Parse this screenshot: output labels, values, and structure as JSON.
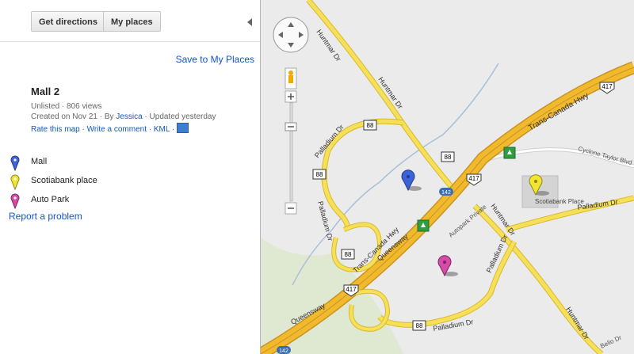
{
  "toolbar": {
    "directions": "Get directions",
    "my_places": "My places"
  },
  "panel": {
    "save_link": "Save to My Places",
    "map_title": "Mall 2",
    "visibility": "Unlisted",
    "views": "806 views",
    "created_prefix": "Created on Nov 21 · By",
    "author": "Jessica",
    "updated": "· Updated yesterday",
    "rate": "Rate this map",
    "comment": "Write a comment",
    "kml": "KML",
    "places": [
      {
        "label": "Mall",
        "color": "#3d63d9"
      },
      {
        "label": "Scotiabank place",
        "color": "#f2e52e"
      },
      {
        "label": "Auto Park",
        "color": "#d64aa8"
      }
    ],
    "report": "Report a problem"
  },
  "map": {
    "labels": {
      "huntmar": "Huntmar Dr",
      "palladium": "Palladium Dr",
      "tch": "Trans-Canada Hwy",
      "queensway": "Queensway",
      "cyclone": "Cyclone Taylor Blvd",
      "autopark": "Autopark Private",
      "scotiabank": "Scotiabank Place",
      "bellotto": "Bello Dr"
    },
    "shields": {
      "r88": "88",
      "r417": "417",
      "r142": "142"
    },
    "colors": {
      "road": "#f6e05a",
      "road_edge": "#d9b92c",
      "highway": "#f1b92e",
      "water": "#a7bfd8"
    }
  }
}
